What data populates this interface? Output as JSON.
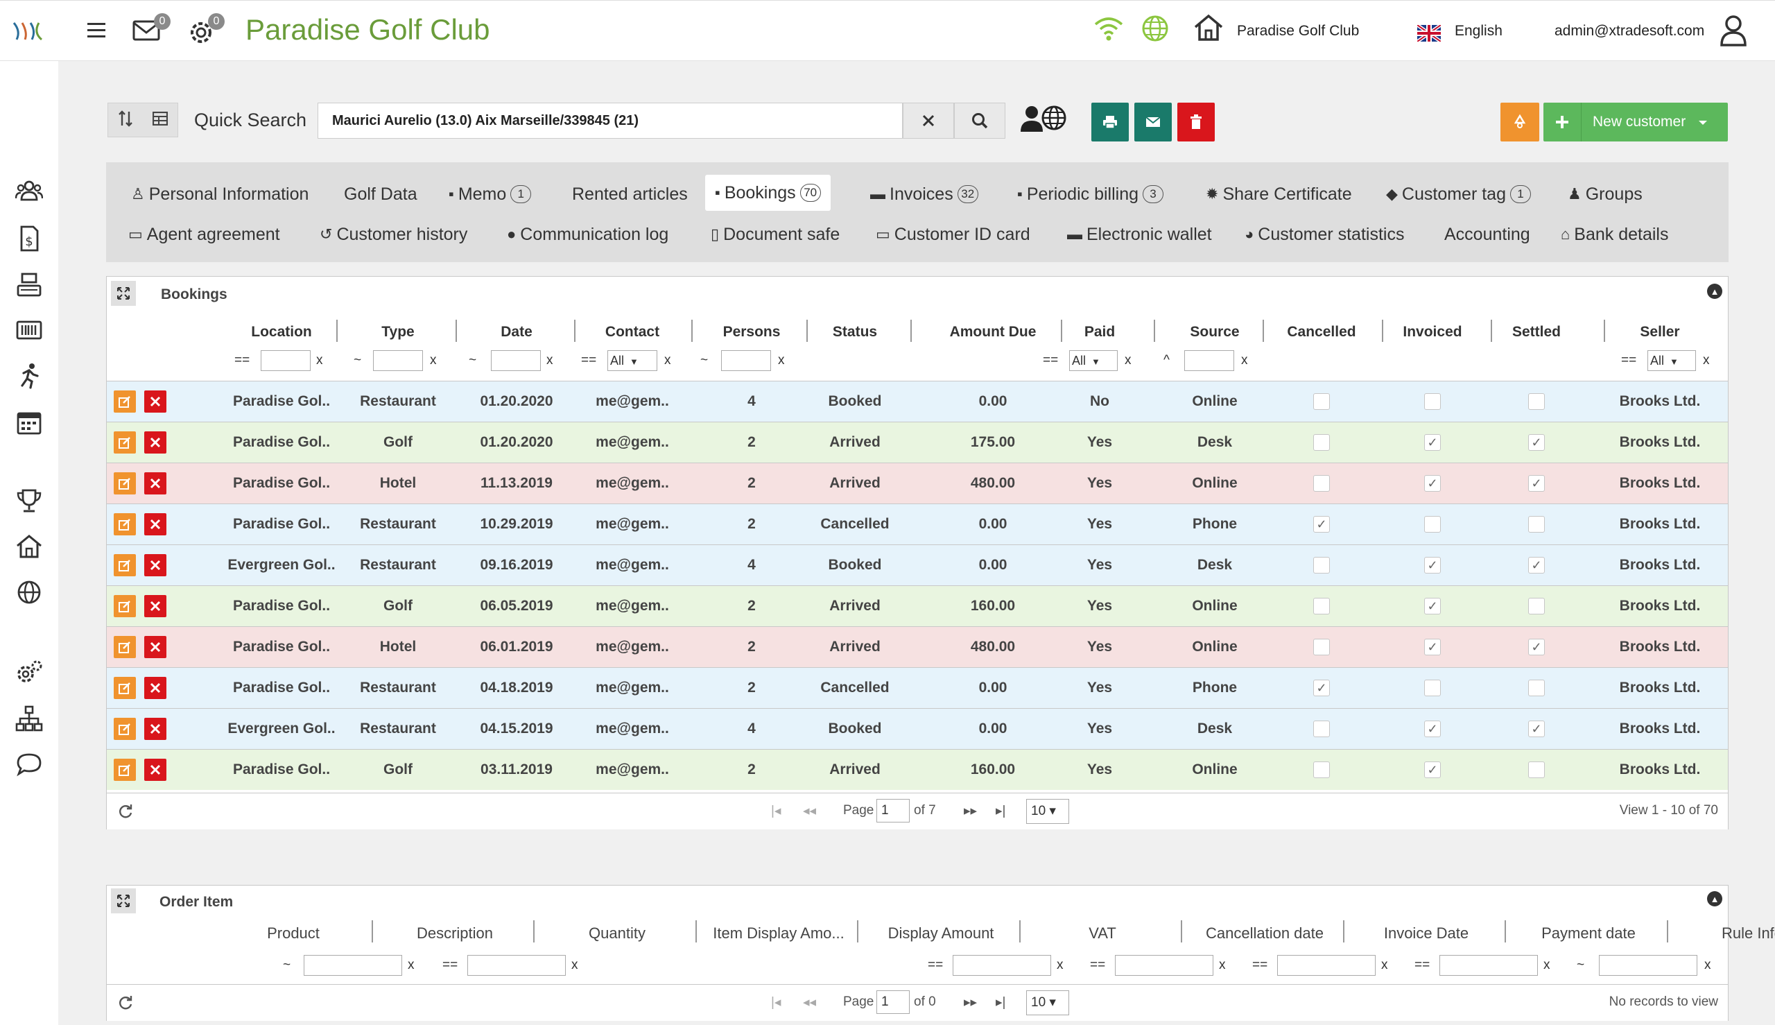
{
  "header": {
    "app_title": "Paradise Golf Club",
    "mail_count": "0",
    "settings_count": "0",
    "club_name": "Paradise Golf Club",
    "language": "English",
    "user_email": "admin@xtradesoft.com"
  },
  "search": {
    "label": "Quick Search",
    "value": "Maurici Aurelio (13.0) Aix Marseille/339845 (21)"
  },
  "toolbar": {
    "new_customer_label": "New customer"
  },
  "tabs": [
    {
      "label": "Personal Information",
      "count": ""
    },
    {
      "label": "Golf Data",
      "count": ""
    },
    {
      "label": "Memo",
      "count": "1"
    },
    {
      "label": "Rented articles",
      "count": ""
    },
    {
      "label": "Bookings",
      "count": "70"
    },
    {
      "label": "Invoices",
      "count": "32"
    },
    {
      "label": "Periodic billing",
      "count": "3"
    },
    {
      "label": "Share Certificate",
      "count": ""
    },
    {
      "label": "Customer tag",
      "count": "1"
    },
    {
      "label": "Groups",
      "count": ""
    },
    {
      "label": "Agent agreement",
      "count": ""
    },
    {
      "label": "Customer history",
      "count": ""
    },
    {
      "label": "Communication log",
      "count": ""
    },
    {
      "label": "Document safe",
      "count": ""
    },
    {
      "label": "Customer ID card",
      "count": ""
    },
    {
      "label": "Electronic wallet",
      "count": ""
    },
    {
      "label": "Customer statistics",
      "count": ""
    },
    {
      "label": "Accounting",
      "count": ""
    },
    {
      "label": "Bank details",
      "count": ""
    }
  ],
  "bookings": {
    "title": "Bookings",
    "columns": [
      "Location",
      "Type",
      "Date",
      "Contact",
      "Persons",
      "Status",
      "Amount Due",
      "Paid",
      "Source",
      "Cancelled",
      "Invoiced",
      "Settled",
      "Seller"
    ],
    "filters": {
      "op_eq": "==",
      "op_like": "~",
      "op_start": "^",
      "clear": "x",
      "all": "All"
    },
    "rows": [
      {
        "location": "Paradise Gol..",
        "type": "Restaurant",
        "date": "01.20.2020",
        "contact": "me@gem..",
        "persons": "4",
        "status": "Booked",
        "amount": "0.00",
        "paid": "No",
        "source": "Online",
        "cancelled": "",
        "invoiced": "",
        "settled": "",
        "seller": "Brooks Ltd.",
        "color": "blue"
      },
      {
        "location": "Paradise Gol..",
        "type": "Golf",
        "date": "01.20.2020",
        "contact": "me@gem..",
        "persons": "2",
        "status": "Arrived",
        "amount": "175.00",
        "paid": "Yes",
        "source": "Desk",
        "cancelled": "",
        "invoiced": "✓",
        "settled": "✓",
        "seller": "Brooks Ltd.",
        "color": "green"
      },
      {
        "location": "Paradise Gol..",
        "type": "Hotel",
        "date": "11.13.2019",
        "contact": "me@gem..",
        "persons": "2",
        "status": "Arrived",
        "amount": "480.00",
        "paid": "Yes",
        "source": "Online",
        "cancelled": "",
        "invoiced": "✓",
        "settled": "✓",
        "seller": "Brooks Ltd.",
        "color": "red"
      },
      {
        "location": "Paradise Gol..",
        "type": "Restaurant",
        "date": "10.29.2019",
        "contact": "me@gem..",
        "persons": "2",
        "status": "Cancelled",
        "amount": "0.00",
        "paid": "Yes",
        "source": "Phone",
        "cancelled": "✓",
        "invoiced": "",
        "settled": "",
        "seller": "Brooks Ltd.",
        "color": "blue"
      },
      {
        "location": "Evergreen Gol..",
        "type": "Restaurant",
        "date": "09.16.2019",
        "contact": "me@gem..",
        "persons": "4",
        "status": "Booked",
        "amount": "0.00",
        "paid": "Yes",
        "source": "Desk",
        "cancelled": "",
        "invoiced": "✓",
        "settled": "✓",
        "seller": "Brooks Ltd.",
        "color": "blue"
      },
      {
        "location": "Paradise Gol..",
        "type": "Golf",
        "date": "06.05.2019",
        "contact": "me@gem..",
        "persons": "2",
        "status": "Arrived",
        "amount": "160.00",
        "paid": "Yes",
        "source": "Online",
        "cancelled": "",
        "invoiced": "✓",
        "settled": "",
        "seller": "Brooks Ltd.",
        "color": "green"
      },
      {
        "location": "Paradise Gol..",
        "type": "Hotel",
        "date": "06.01.2019",
        "contact": "me@gem..",
        "persons": "2",
        "status": "Arrived",
        "amount": "480.00",
        "paid": "Yes",
        "source": "Online",
        "cancelled": "",
        "invoiced": "✓",
        "settled": "✓",
        "seller": "Brooks Ltd.",
        "color": "red"
      },
      {
        "location": "Paradise Gol..",
        "type": "Restaurant",
        "date": "04.18.2019",
        "contact": "me@gem..",
        "persons": "2",
        "status": "Cancelled",
        "amount": "0.00",
        "paid": "Yes",
        "source": "Phone",
        "cancelled": "✓",
        "invoiced": "",
        "settled": "",
        "seller": "Brooks Ltd.",
        "color": "blue"
      },
      {
        "location": "Evergreen Gol..",
        "type": "Restaurant",
        "date": "04.15.2019",
        "contact": "me@gem..",
        "persons": "4",
        "status": "Booked",
        "amount": "0.00",
        "paid": "Yes",
        "source": "Desk",
        "cancelled": "",
        "invoiced": "✓",
        "settled": "✓",
        "seller": "Brooks Ltd.",
        "color": "blue"
      },
      {
        "location": "Paradise Gol..",
        "type": "Golf",
        "date": "03.11.2019",
        "contact": "me@gem..",
        "persons": "2",
        "status": "Arrived",
        "amount": "160.00",
        "paid": "Yes",
        "source": "Online",
        "cancelled": "",
        "invoiced": "✓",
        "settled": "",
        "seller": "Brooks Ltd.",
        "color": "green"
      }
    ],
    "pager": {
      "page_label": "Page",
      "page": "1",
      "of_label": "of 7",
      "page_size": "10",
      "summary": "View 1 - 10 of 70"
    }
  },
  "order_items": {
    "title": "Order Item",
    "columns": [
      "Product",
      "Description",
      "Quantity",
      "Item Display Amo...",
      "Display Amount",
      "VAT",
      "Cancellation date",
      "Invoice Date",
      "Payment date",
      "Rule Info"
    ],
    "pager": {
      "page_label": "Page",
      "page": "1",
      "of_label": "of 0",
      "page_size": "10",
      "summary": "No records to view"
    }
  },
  "colors": {
    "brand_green": "#6a9c3a",
    "accent_green": "#5cb85c",
    "accent_orange": "#f0932e",
    "teal": "#1a7a6a",
    "danger": "#d9161c",
    "row_blue": "#e6f3fb",
    "row_green": "#e9f5e0",
    "row_red": "#f6e1e1"
  }
}
